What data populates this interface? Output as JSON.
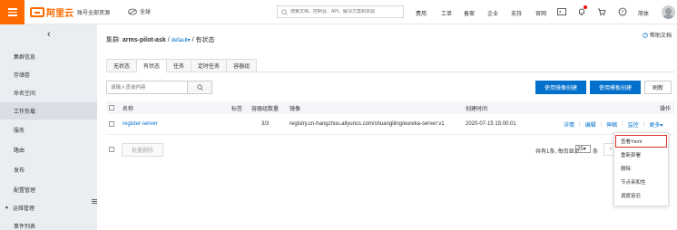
{
  "topbar": {
    "brand": "阿里云",
    "account": "账号全部资源",
    "region": "全球",
    "search_placeholder": "搜索文档、控制台、API、解决方案和资源",
    "nav": [
      "费用",
      "工单",
      "备案",
      "企业",
      "支持",
      "官网"
    ],
    "lang": "简体",
    "accent": "#ff6a00"
  },
  "sidebar": {
    "items": [
      {
        "label": "集群信息"
      },
      {
        "label": "存储卷"
      },
      {
        "label": "命名空间"
      },
      {
        "label": "工作负载"
      },
      {
        "label": "服务"
      },
      {
        "label": "路由"
      },
      {
        "label": "发布"
      },
      {
        "label": "配置管理"
      },
      {
        "label": "运维管理"
      },
      {
        "label": "事件列表"
      }
    ]
  },
  "main": {
    "breadcrumb": {
      "prefix": "集群: ",
      "cluster": "arms-pilot-ask",
      "sep1": "/",
      "namespace": "default",
      "sep2": "/",
      "page": "有状态"
    },
    "help": "帮助文档",
    "tabs": [
      "无状态",
      "有状态",
      "任务",
      "定时任务",
      "容器组"
    ],
    "search_placeholder": "请输入查询内容",
    "buttons": {
      "create_by_image": "使用镜像创建",
      "create_by_template": "使用模板创建",
      "refresh": "刷新"
    },
    "table": {
      "headers": {
        "name": "名称",
        "label": "标签",
        "pods": "容器组数量",
        "image": "镜像",
        "created": "创建时间",
        "actions": "操作"
      },
      "rows": [
        {
          "name": "register-server",
          "pods": "3/3",
          "image": "registry.cn-hangzhou.aliyuncs.com/shuangliing/eureka-server:v1",
          "created": "2020-07-15 15:00:01",
          "actions": [
            "详情",
            "编辑",
            "伸缩",
            "监控",
            "更多"
          ]
        }
      ]
    },
    "batch_delete": "批量删除",
    "pager": {
      "summary": "共有1条, 每页显示:",
      "page_size": "25",
      "unit": "条",
      "prev": "«"
    },
    "more_menu": [
      "查看Yaml",
      "重新部署",
      "删除",
      "节点亲和性",
      "调度容忍"
    ]
  },
  "colors": {
    "primary": "#0070cc",
    "highlight": "#d9302c"
  }
}
